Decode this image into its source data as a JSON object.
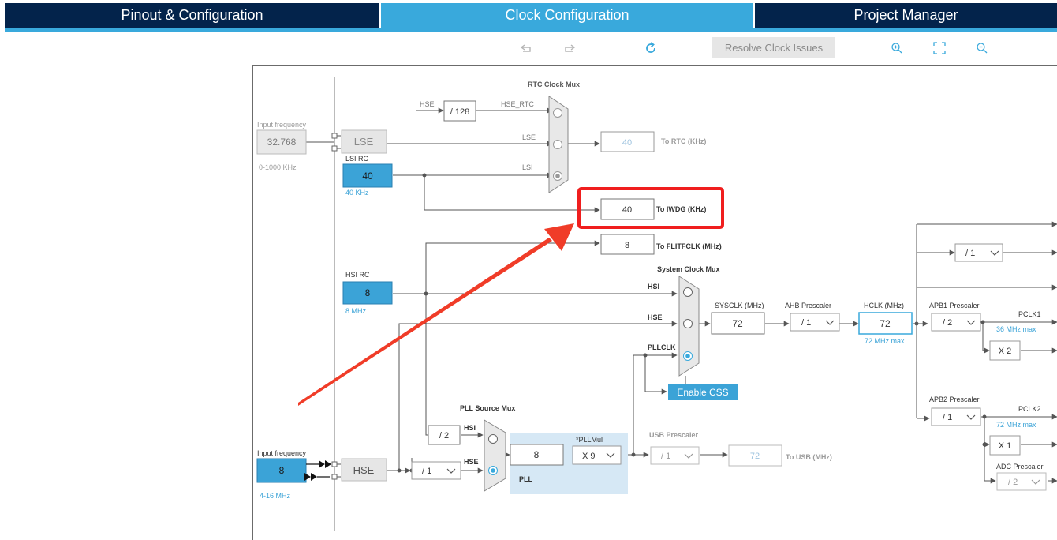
{
  "tabs": {
    "pinout": "Pinout & Configuration",
    "clock": "Clock Configuration",
    "project": "Project Manager"
  },
  "toolbar": {
    "undo_icon": "undo-icon",
    "redo_icon": "redo-icon",
    "refresh_icon": "refresh-icon",
    "resolve_label": "Resolve Clock Issues",
    "zoom_in_icon": "zoom-in-icon",
    "fit_icon": "fit-to-screen-icon",
    "zoom_out_icon": "zoom-out-icon"
  },
  "colors": {
    "tab_dark": "#03234b",
    "tab_active": "#39a9dc",
    "block_blue": "#3ba3d7",
    "highlight_red": "#f01e1e",
    "pll_area": "#d6e8f5"
  },
  "diagram": {
    "lse_input_label": "Input frequency",
    "lse_input_value": "32.768",
    "lse_range": "0-1000 KHz",
    "lse_label": "LSE",
    "lsi_label": "LSI RC",
    "lsi_value": "40",
    "lsi_unit": "40 KHz",
    "hse_rtc_in": "HSE",
    "hse_rtc_div": "/ 128",
    "hse_rtc_label": "HSE_RTC",
    "rtc_lse": "LSE",
    "rtc_lsi": "LSI",
    "rtc_mux_label": "RTC Clock Mux",
    "rtc_value": "40",
    "rtc_label": "To RTC (KHz)",
    "iwdg_value": "40",
    "iwdg_label": "To IWDG (KHz)",
    "flit_value": "8",
    "flit_label": "To FLITFCLK (MHz)",
    "hsi_label": "HSI RC",
    "hsi_value": "8",
    "hsi_unit": "8 MHz",
    "sys_mux_label": "System Clock Mux",
    "sys_hsi": "HSI",
    "sys_hse": "HSE",
    "sys_pllclk": "PLLCLK",
    "enable_css": "Enable CSS",
    "sysclk_label": "SYSCLK (MHz)",
    "sysclk_value": "72",
    "ahb_label": "AHB Prescaler",
    "ahb_value": "/ 1",
    "hclk_label": "HCLK (MHz)",
    "hclk_value": "72",
    "hclk_max": "72 MHz max",
    "right_div_value": "/ 1",
    "apb1_label": "APB1 Prescaler",
    "apb1_value": "/ 2",
    "pclk1_label": "PCLK1",
    "pclk1_max": "36 MHz max",
    "apb1_mul": "X 2",
    "apb2_label": "APB2 Prescaler",
    "apb2_value": "/ 1",
    "pclk2_label": "PCLK2",
    "pclk2_max": "72 MHz max",
    "apb2_mul": "X 1",
    "adc_label": "ADC Prescaler",
    "adc_value": "/ 2",
    "pll_src_label": "PLL Source Mux",
    "pll_hsi_div": "/ 2",
    "pll_src_hsi": "HSI",
    "pll_src_hse": "HSE",
    "pll_in_value": "8",
    "pllmul_label": "*PLLMul",
    "pllmul_value": "X 9",
    "pll_label": "PLL",
    "usb_label": "USB Prescaler",
    "usb_value": "/ 1",
    "usb_out_value": "72",
    "usb_out_label": "To USB (MHz)",
    "hse_input_label": "Input frequency",
    "hse_input_value": "8",
    "hse_range": "4-16 MHz",
    "hse_label": "HSE",
    "hse_div_value": "/ 1"
  }
}
